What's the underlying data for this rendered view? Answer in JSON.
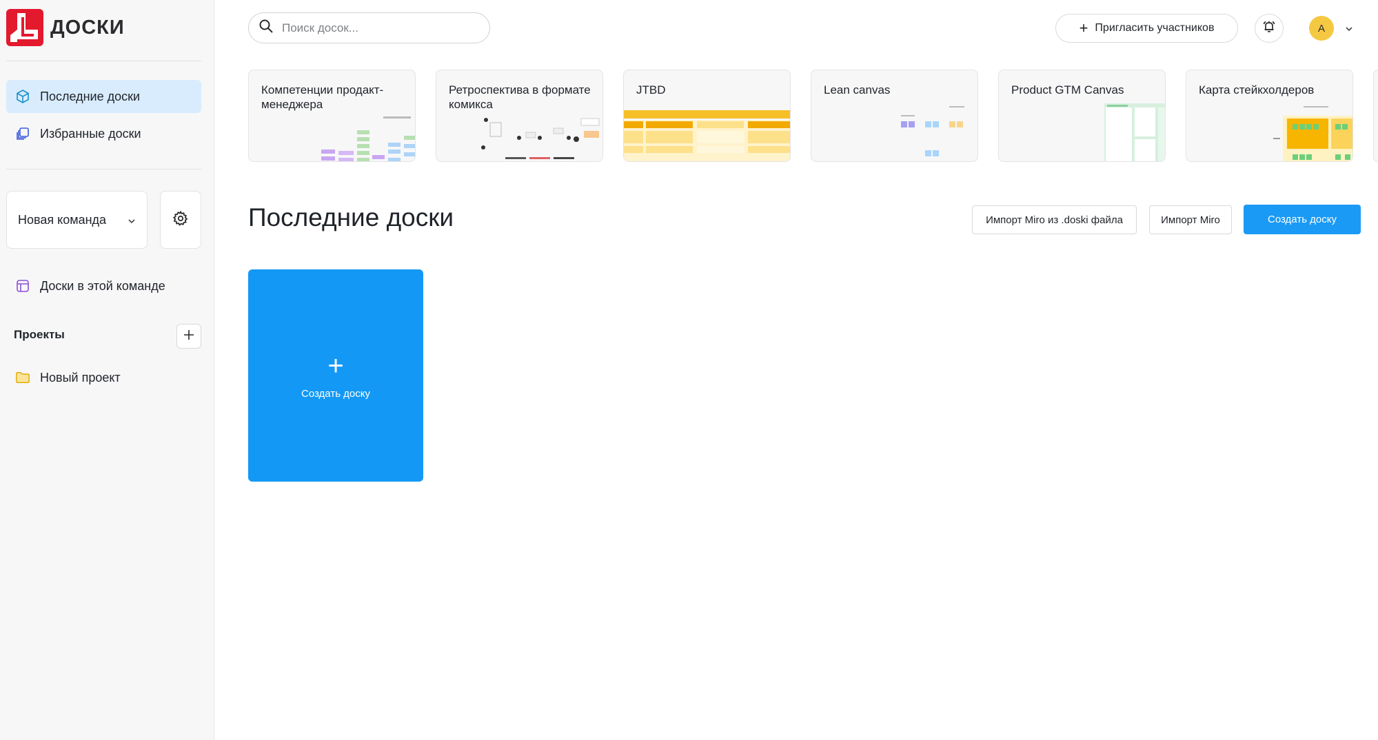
{
  "brand": {
    "name": "ДОСКИ",
    "color": "#e3192e"
  },
  "sidebar": {
    "nav": [
      {
        "label": "Последние доски",
        "icon": "cube-icon",
        "active": true
      },
      {
        "label": "Избранные доски",
        "icon": "layers-icon",
        "active": false
      }
    ],
    "team": {
      "name": "Новая команда"
    },
    "team_boards": {
      "label": "Доски в этой команде",
      "icon": "board-grid-icon"
    },
    "projects": {
      "title": "Проекты",
      "items": [
        {
          "label": "Новый проект",
          "icon": "folder-icon"
        }
      ]
    }
  },
  "header": {
    "search_placeholder": "Поиск досок...",
    "invite_label": "Пригласить участников",
    "avatar_initial": "A"
  },
  "templates": [
    {
      "title": "Компетенции продакт-менеджера"
    },
    {
      "title": "Ретроспектива в формате комикса"
    },
    {
      "title": "JTBD"
    },
    {
      "title": "Lean canvas"
    },
    {
      "title": "Product GTM Canvas"
    },
    {
      "title": "Карта стейкхолдеров"
    }
  ],
  "main": {
    "title": "Последние доски",
    "import_doski_label": "Импорт Miro из .doski файла",
    "import_miro_label": "Импорт Miro",
    "create_label": "Создать доску",
    "create_card_label": "Создать доску"
  },
  "colors": {
    "accent": "#1a9af5",
    "active_nav": "#d8ecfd",
    "avatar": "#f5c842"
  }
}
